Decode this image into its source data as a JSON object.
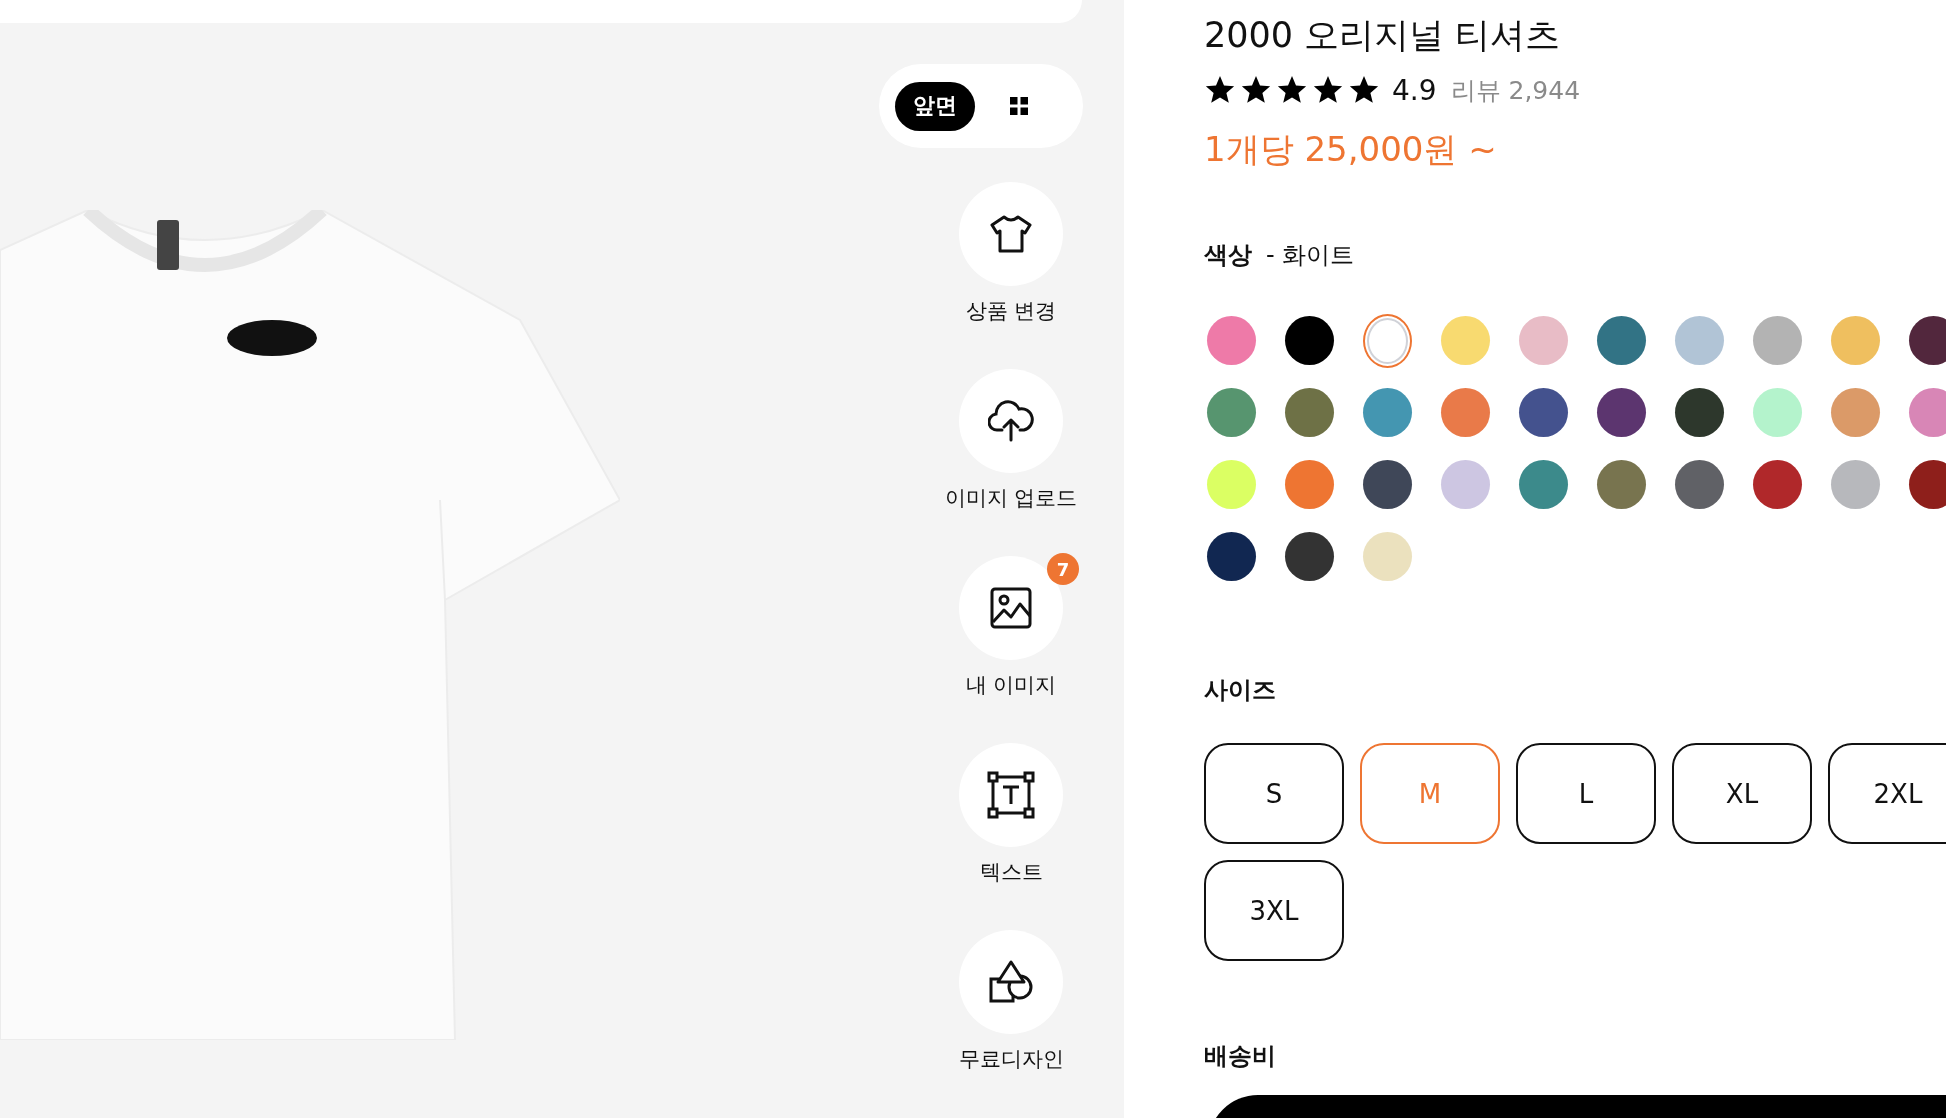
{
  "view_toggle": {
    "options": [
      {
        "kind": "text",
        "label": "앞면",
        "selected": true
      },
      {
        "kind": "grid",
        "selected": false
      }
    ]
  },
  "tools": [
    {
      "kind": "shirt",
      "label": "상품 변경"
    },
    {
      "kind": "upload",
      "label": "이미지 업로드"
    },
    {
      "kind": "image",
      "label": "내 이미지",
      "badge": "7"
    },
    {
      "kind": "text",
      "label": "텍스트"
    },
    {
      "kind": "shapes",
      "label": "무료디자인"
    }
  ],
  "product": {
    "title": "2000 오리지널 티셔츠",
    "rating": {
      "stars": 5,
      "score": "4.9",
      "reviews": "리뷰 2,944"
    },
    "price": "1개당 25,000원 ~"
  },
  "color": {
    "label": "색상",
    "value": "- 화이트",
    "swatches": [
      {
        "color": "#ee7aa8",
        "selected": false
      },
      {
        "color": "#000000",
        "selected": false
      },
      {
        "color": "#ffffff",
        "selected": true
      },
      {
        "color": "#f8da70",
        "selected": false
      },
      {
        "color": "#e8bcc6",
        "selected": false
      },
      {
        "color": "#327385",
        "selected": false
      },
      {
        "color": "#b1c4d6",
        "selected": false
      },
      {
        "color": "#b3b3b3",
        "selected": false
      },
      {
        "color": "#efbf5f",
        "selected": false
      },
      {
        "color": "#52273d",
        "selected": false
      },
      {
        "color": "#57956f",
        "selected": false
      },
      {
        "color": "#6e7146",
        "selected": false
      },
      {
        "color": "#4496b1",
        "selected": false
      },
      {
        "color": "#e97a49",
        "selected": false
      },
      {
        "color": "#44528e",
        "selected": false
      },
      {
        "color": "#5c356f",
        "selected": false
      },
      {
        "color": "#2d372c",
        "selected": false
      },
      {
        "color": "#b4f3cc",
        "selected": false
      },
      {
        "color": "#db9a68",
        "selected": false
      },
      {
        "color": "#d886b6",
        "selected": false
      },
      {
        "color": "#dbff63",
        "selected": false
      },
      {
        "color": "#ee7532",
        "selected": false
      },
      {
        "color": "#3f4758",
        "selected": false
      },
      {
        "color": "#cdc6e2",
        "selected": false
      },
      {
        "color": "#3c8a8b",
        "selected": false
      },
      {
        "color": "#78744f",
        "selected": false
      },
      {
        "color": "#606166",
        "selected": false
      },
      {
        "color": "#b0282a",
        "selected": false
      },
      {
        "color": "#b7b8bc",
        "selected": false
      },
      {
        "color": "#8e1f1b",
        "selected": false
      },
      {
        "color": "#112751",
        "selected": false
      },
      {
        "color": "#333333",
        "selected": false
      },
      {
        "color": "#ebe1be",
        "selected": false
      }
    ]
  },
  "size": {
    "label": "사이즈",
    "options": [
      {
        "label": "S",
        "selected": false
      },
      {
        "label": "M",
        "selected": true
      },
      {
        "label": "L",
        "selected": false
      },
      {
        "label": "XL",
        "selected": false
      },
      {
        "label": "2XL",
        "selected": false
      },
      {
        "label": "3XL",
        "selected": false
      }
    ]
  },
  "shipping": {
    "label": "배송비"
  }
}
